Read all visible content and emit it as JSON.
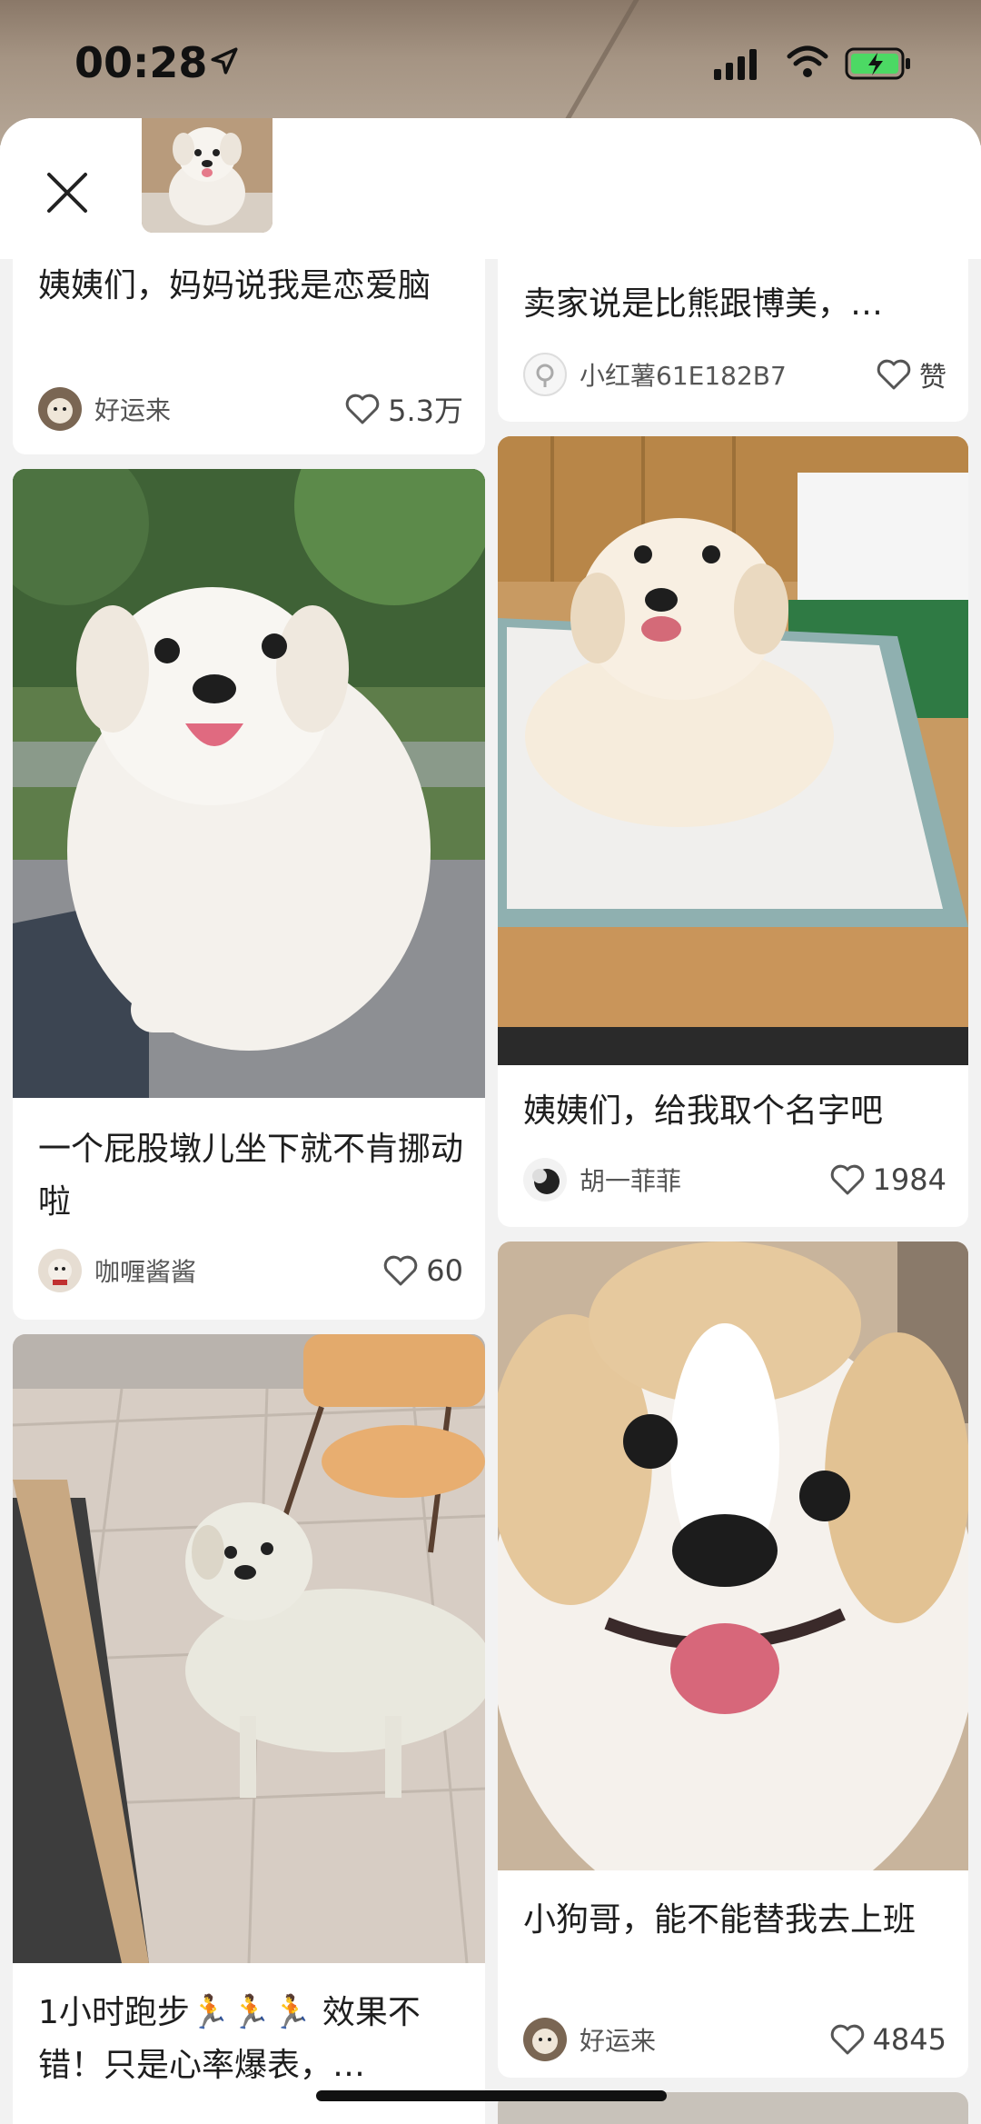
{
  "status_bar": {
    "time": "00:28",
    "location_icon": "location-arrow-icon",
    "signal_icon": "signal-bars-icon",
    "wifi_icon": "wifi-icon",
    "battery_icon": "battery-charging-icon"
  },
  "header": {
    "close_icon": "close-icon"
  },
  "cards": [
    {
      "title": "姨姨们，妈妈说我是恋爱脑",
      "author": "好运来",
      "likes": "5.3万"
    },
    {
      "title": "一个屁股墩儿坐下就不肯挪动啦",
      "author": "咖喱酱酱",
      "likes": "60"
    },
    {
      "title": "1小时跑步🏃🏃🏃 效果不错！只是心率爆表，…",
      "author": "",
      "likes": ""
    },
    {
      "title": "卖家说是比熊跟博美，…",
      "author": "小红薯61E182B7",
      "likes": "赞"
    },
    {
      "title": "姨姨们，给我取个名字吧",
      "author": "胡一菲菲",
      "likes": "1984"
    },
    {
      "title": "小狗哥，能不能替我去上班",
      "author": "好运来",
      "likes": "4845"
    }
  ],
  "colors": {
    "accent_battery": "#4cd964",
    "background": "#f2f2f2"
  }
}
